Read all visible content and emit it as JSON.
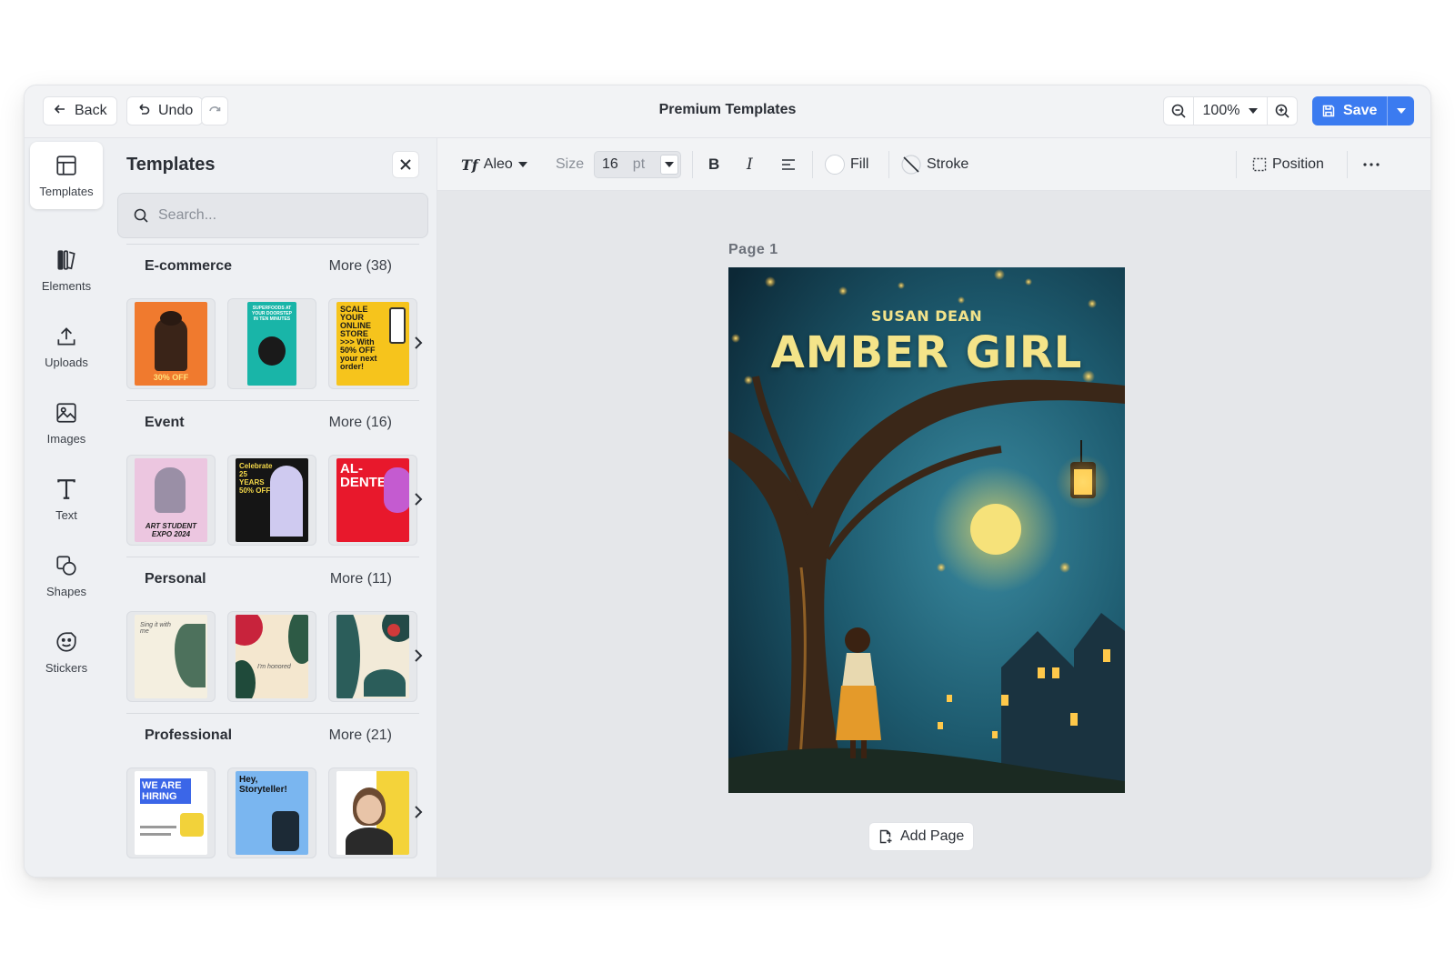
{
  "topbar": {
    "back_label": "Back",
    "undo_label": "Undo",
    "title": "Premium Templates",
    "zoom": "100%",
    "save_label": "Save"
  },
  "rail": {
    "items": [
      {
        "label": "Templates",
        "icon": "layout-icon"
      },
      {
        "label": "Elements",
        "icon": "elements-icon"
      },
      {
        "label": "Uploads",
        "icon": "upload-icon"
      },
      {
        "label": "Images",
        "icon": "image-icon"
      },
      {
        "label": "Text",
        "icon": "text-icon"
      },
      {
        "label": "Shapes",
        "icon": "shapes-icon"
      },
      {
        "label": "Stickers",
        "icon": "sticker-icon"
      }
    ]
  },
  "panel": {
    "title": "Templates",
    "search_placeholder": "Search...",
    "sections": [
      {
        "name": "E-commerce",
        "more": "More (38)",
        "thumbs": [
          {
            "text": "30% OFF"
          },
          {
            "text": "SUPERFOODS AT YOUR DOORSTEP IN TEN MINUTES"
          },
          {
            "text": "SCALE YOUR ONLINE STORE >>> With 50% OFF your next order!"
          }
        ]
      },
      {
        "name": "Event",
        "more": "More (16)",
        "thumbs": [
          {
            "text": "ART STUDENT EXPO 2024"
          },
          {
            "text": "Celebrate 25 YEARS 50% OFF"
          },
          {
            "text": "AL- DENTE"
          }
        ]
      },
      {
        "name": "Personal",
        "more": "More (11)",
        "thumbs": [
          {
            "text": "Sing it with me"
          },
          {
            "text": "I'm honored"
          },
          {
            "text": ""
          }
        ]
      },
      {
        "name": "Professional",
        "more": "More (21)",
        "thumbs": [
          {
            "text": "WE ARE HIRING"
          },
          {
            "text": "Hey, Storyteller!"
          },
          {
            "text": ""
          }
        ]
      }
    ]
  },
  "toolbar": {
    "font": "Aleo",
    "size_label": "Size",
    "size_value": "16",
    "size_unit": "pt",
    "fill_label": "Fill",
    "stroke_label": "Stroke",
    "position_label": "Position"
  },
  "canvas": {
    "page_label": "Page  1",
    "cover_author": "SUSAN DEAN",
    "cover_title": "AMBER GIRL",
    "add_page_label": "Add Page"
  },
  "colors": {
    "accent": "#3b7bf0",
    "cover_text": "#f4e489"
  }
}
